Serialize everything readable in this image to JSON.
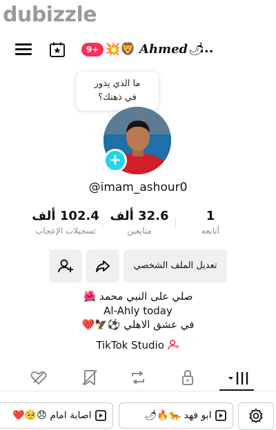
{
  "watermark": "dubizzle",
  "top_bar": {
    "notification_count": "9+",
    "emojis": "💥🦁",
    "title": "Ahmed",
    "title_emoji": "🌶",
    "title_ellipsis": "..."
  },
  "bubble": {
    "text": "ما الذي يدور\nفي ذهنك؟"
  },
  "profile": {
    "handle": "@imam_ashour0"
  },
  "stats": [
    {
      "value": "1",
      "label": "أتابعه"
    },
    {
      "value": "32.6 ألف",
      "label": "متابعين"
    },
    {
      "value": "102.4 ألف",
      "label": "تسجيلات الإعجاب"
    }
  ],
  "buttons": {
    "edit_profile": "تعديل الملف الشخصي"
  },
  "bio": {
    "line1": "صلي على النبي محمد 🌺",
    "line2": "Al-Ahly today",
    "line3": "في عشق الاهلي ⚽🦅❤️"
  },
  "studio": {
    "label": "TikTok Studio"
  },
  "chips": [
    {
      "label": "ابو فهد 🐆🔥🌶"
    },
    {
      "label": "اصابة امام 😞🥺❤️"
    }
  ],
  "colors": {
    "accent": "#fe2c55",
    "add_badge": "#20d5ec",
    "button_bg": "#efefef"
  }
}
